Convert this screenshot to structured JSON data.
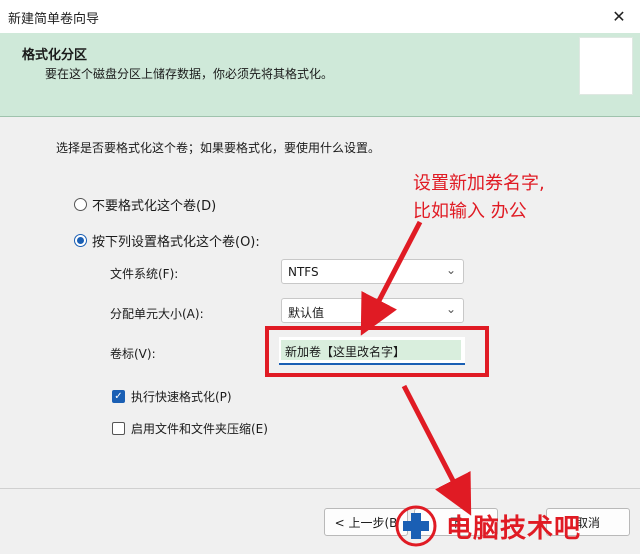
{
  "window": {
    "title": "新建简单卷向导",
    "close_glyph": "✕"
  },
  "header": {
    "title": "格式化分区",
    "subtitle": "要在这个磁盘分区上储存数据，你必须先将其格式化。"
  },
  "main": {
    "intro": "选择是否要格式化这个卷；如果要格式化，要使用什么设置。",
    "radio_no_format": "不要格式化这个卷(D)",
    "radio_format": "按下列设置格式化这个卷(O):",
    "radio_selected": "format",
    "filesystem_label": "文件系统(F):",
    "filesystem_value": "NTFS",
    "alloc_label": "分配单元大小(A):",
    "alloc_value": "默认值",
    "volume_label": "卷标(V):",
    "volume_value": "新加卷【这里改名字】",
    "quick_format_label": "执行快速格式化(P)",
    "quick_format_checked": true,
    "compress_label": "启用文件和文件夹压缩(E)",
    "compress_checked": false
  },
  "footer": {
    "back_label": "< 上一步(B",
    "next_label": "下",
    "cancel_label": "取消"
  },
  "annotation": {
    "line1": "设置新加券名字,",
    "line2": "比如输入  办公",
    "color": "#e01b24"
  },
  "watermark": {
    "text": "电脑技术吧"
  },
  "colors": {
    "header_bg": "#cfe9d9",
    "accent": "#1a5fb4"
  }
}
